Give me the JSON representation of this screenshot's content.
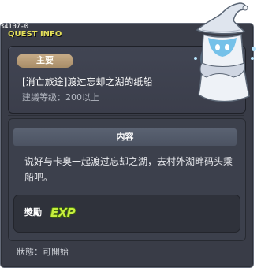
{
  "quest": {
    "id": "34107-0",
    "title": "QUEST INFO",
    "category": "主要",
    "name": "[消亡旅途]渡过忘却之湖的纸船",
    "level": "建議等级：200以上"
  },
  "content": {
    "header": "内容",
    "text": "说好与卡奥一起渡过忘却之湖，去村外湖畔码头乘船吧。"
  },
  "reward": {
    "label": "獎勵",
    "icon": "EXP"
  },
  "status": {
    "text": "狀態：可開始"
  },
  "npc": {
    "icon": "wizard-npc-icon"
  }
}
